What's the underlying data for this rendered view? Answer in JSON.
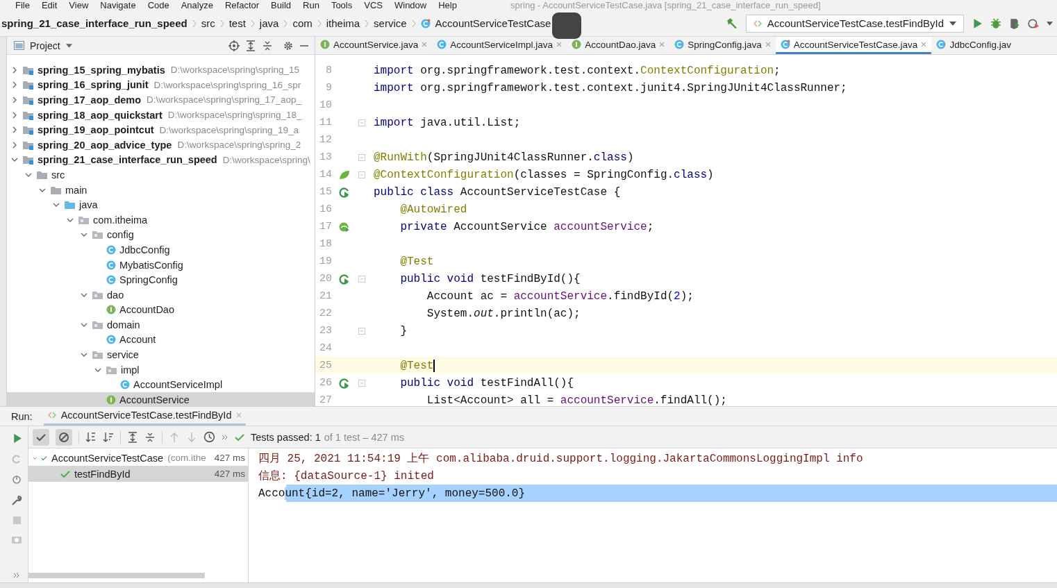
{
  "window": {
    "title": "spring - AccountServiceTestCase.java [spring_21_case_interface_run_speed]"
  },
  "menu": [
    "File",
    "Edit",
    "View",
    "Navigate",
    "Code",
    "Analyze",
    "Refactor",
    "Build",
    "Run",
    "Tools",
    "VCS",
    "Window",
    "Help"
  ],
  "breadcrumbs": [
    {
      "label": "spring_21_case_interface_run_speed",
      "kind": "module"
    },
    {
      "label": "src",
      "kind": "folder"
    },
    {
      "label": "test",
      "kind": "folder"
    },
    {
      "label": "java",
      "kind": "folder"
    },
    {
      "label": "com",
      "kind": "folder"
    },
    {
      "label": "itheima",
      "kind": "folder"
    },
    {
      "label": "service",
      "kind": "folder"
    },
    {
      "label": "AccountServiceTestCase",
      "kind": "class"
    }
  ],
  "run_config": {
    "label": "AccountServiceTestCase.testFindById"
  },
  "project": {
    "title": "Project",
    "tree": [
      {
        "name": "spring_15_spring_mybatis",
        "path": "D:\\workspace\\spring\\spring_15",
        "kind": "module",
        "expanded": false,
        "selected": false
      },
      {
        "name": "spring_16_spring_junit",
        "path": "D:\\workspace\\spring\\spring_16_spr",
        "kind": "module",
        "expanded": false,
        "selected": false
      },
      {
        "name": "spring_17_aop_demo",
        "path": "D:\\workspace\\spring\\spring_17_aop_",
        "kind": "module",
        "expanded": false,
        "selected": false
      },
      {
        "name": "spring_18_aop_quickstart",
        "path": "D:\\workspace\\spring\\spring_18_",
        "kind": "module",
        "expanded": false,
        "selected": false
      },
      {
        "name": "spring_19_aop_pointcut",
        "path": "D:\\workspace\\spring\\spring_19_a",
        "kind": "module",
        "expanded": false,
        "selected": false
      },
      {
        "name": "spring_20_aop_advice_type",
        "path": "D:\\workspace\\spring\\spring_2",
        "kind": "module",
        "expanded": false,
        "selected": false
      },
      {
        "name": "spring_21_case_interface_run_speed",
        "path": "D:\\workspace\\spring\\",
        "kind": "module",
        "expanded": true,
        "selected": false,
        "children": [
          {
            "name": "src",
            "kind": "folder",
            "expanded": true,
            "selected": false,
            "children": [
              {
                "name": "main",
                "kind": "folder",
                "expanded": true,
                "selected": false,
                "children": [
                  {
                    "name": "java",
                    "kind": "source",
                    "expanded": true,
                    "selected": false,
                    "children": [
                      {
                        "name": "com.itheima",
                        "kind": "package",
                        "expanded": true,
                        "selected": false,
                        "children": [
                          {
                            "name": "config",
                            "kind": "package",
                            "expanded": true,
                            "selected": false,
                            "children": [
                              {
                                "name": "JdbcConfig",
                                "kind": "class",
                                "selected": false
                              },
                              {
                                "name": "MybatisConfig",
                                "kind": "class",
                                "selected": false
                              },
                              {
                                "name": "SpringConfig",
                                "kind": "class",
                                "selected": false
                              }
                            ]
                          },
                          {
                            "name": "dao",
                            "kind": "package",
                            "expanded": true,
                            "selected": false,
                            "children": [
                              {
                                "name": "AccountDao",
                                "kind": "interface",
                                "selected": false
                              }
                            ]
                          },
                          {
                            "name": "domain",
                            "kind": "package",
                            "expanded": true,
                            "selected": false,
                            "children": [
                              {
                                "name": "Account",
                                "kind": "class",
                                "selected": false
                              }
                            ]
                          },
                          {
                            "name": "service",
                            "kind": "package",
                            "expanded": true,
                            "selected": false,
                            "children": [
                              {
                                "name": "impl",
                                "kind": "package",
                                "expanded": true,
                                "selected": false,
                                "children": [
                                  {
                                    "name": "AccountServiceImpl",
                                    "kind": "class",
                                    "selected": false
                                  }
                                ]
                              },
                              {
                                "name": "AccountService",
                                "kind": "interface",
                                "selected": true
                              }
                            ]
                          }
                        ]
                      }
                    ]
                  }
                ]
              }
            ]
          }
        ]
      }
    ]
  },
  "editor": {
    "tabs": [
      {
        "label": "AccountService.java",
        "kind": "interface",
        "selected": false,
        "closable": true
      },
      {
        "label": "AccountServiceImpl.java",
        "kind": "class",
        "selected": false,
        "closable": true
      },
      {
        "label": "AccountDao.java",
        "kind": "interface",
        "selected": false,
        "closable": true
      },
      {
        "label": "SpringConfig.java",
        "kind": "class",
        "selected": false,
        "closable": true
      },
      {
        "label": "AccountServiceTestCase.java",
        "kind": "test",
        "selected": true,
        "closable": true
      },
      {
        "label": "JdbcConfig.jav",
        "kind": "class",
        "selected": false,
        "closable": false
      }
    ],
    "lines": [
      {
        "num": "8",
        "fold": false,
        "current": false,
        "tokens": [
          {
            "text": "import",
            "kind": "keyword"
          },
          {
            "text": " org.springframework.test.context.",
            "kind": "plain"
          },
          {
            "text": "ContextConfiguration",
            "kind": "annotation"
          },
          {
            "text": ";",
            "kind": "plain"
          }
        ]
      },
      {
        "num": "9",
        "fold": false,
        "current": false,
        "tokens": [
          {
            "text": "import",
            "kind": "keyword"
          },
          {
            "text": " org.springframework.test.context.junit4.SpringJUnit4ClassRunner;",
            "kind": "plain"
          }
        ]
      },
      {
        "num": "10",
        "fold": false,
        "current": false
      },
      {
        "num": "11",
        "fold": true,
        "current": false,
        "tokens": [
          {
            "text": "import",
            "kind": "keyword"
          },
          {
            "text": " java.util.List;",
            "kind": "plain"
          }
        ]
      },
      {
        "num": "12",
        "fold": false,
        "current": false
      },
      {
        "num": "13",
        "fold": true,
        "current": false,
        "tokens": [
          {
            "text": "@RunWith",
            "kind": "annotation"
          },
          {
            "text": "(SpringJUnit4ClassRunner.",
            "kind": "plain"
          },
          {
            "text": "class",
            "kind": "keyword"
          },
          {
            "text": ")",
            "kind": "plain"
          }
        ]
      },
      {
        "num": "14",
        "fold": true,
        "current": false,
        "gutter": {
          "kind": "leaf"
        },
        "tokens": [
          {
            "text": "@ContextConfiguration",
            "kind": "annotation"
          },
          {
            "text": "(classes = SpringConfig.",
            "kind": "plain"
          },
          {
            "text": "class",
            "kind": "keyword"
          },
          {
            "text": ")",
            "kind": "plain"
          }
        ]
      },
      {
        "num": "15",
        "fold": false,
        "current": false,
        "gutter": {
          "kind": "run"
        },
        "tokens": [
          {
            "text": "public class",
            "kind": "keyword"
          },
          {
            "text": " AccountServiceTestCase {",
            "kind": "plain"
          }
        ]
      },
      {
        "num": "16",
        "fold": false,
        "current": false,
        "tokens": [
          {
            "text": "    @Autowired",
            "kind": "annotation"
          }
        ]
      },
      {
        "num": "17",
        "fold": false,
        "current": false,
        "gutter": {
          "kind": "bean"
        },
        "tokens": [
          {
            "text": "    private",
            "kind": "keyword"
          },
          {
            "text": " AccountService ",
            "kind": "plain"
          },
          {
            "text": "accountService",
            "kind": "field"
          },
          {
            "text": ";",
            "kind": "plain"
          }
        ]
      },
      {
        "num": "18",
        "fold": false,
        "current": false
      },
      {
        "num": "19",
        "fold": false,
        "current": false,
        "tokens": [
          {
            "text": "    @Test",
            "kind": "annotation"
          }
        ]
      },
      {
        "num": "20",
        "fold": true,
        "current": false,
        "gutter": {
          "kind": "run"
        },
        "tokens": [
          {
            "text": "    public void",
            "kind": "keyword"
          },
          {
            "text": " testFindById(){",
            "kind": "plain"
          }
        ]
      },
      {
        "num": "21",
        "fold": false,
        "current": false,
        "tokens": [
          {
            "text": "        Account ac = ",
            "kind": "plain"
          },
          {
            "text": "accountService",
            "kind": "field"
          },
          {
            "text": ".findById(",
            "kind": "plain"
          },
          {
            "text": "2",
            "kind": "number"
          },
          {
            "text": ");",
            "kind": "plain"
          }
        ]
      },
      {
        "num": "22",
        "fold": false,
        "current": false,
        "tokens": [
          {
            "text": "        System.",
            "kind": "plain"
          },
          {
            "text": "out",
            "kind": "static"
          },
          {
            "text": ".println(ac);",
            "kind": "plain"
          }
        ]
      },
      {
        "num": "23",
        "fold": true,
        "current": false,
        "tokens": [
          {
            "text": "    }",
            "kind": "plain"
          }
        ]
      },
      {
        "num": "24",
        "fold": false,
        "current": false
      },
      {
        "num": "25",
        "fold": false,
        "current": true,
        "tokens": [
          {
            "text": "    @Test",
            "kind": "annotation"
          }
        ]
      },
      {
        "num": "26",
        "fold": true,
        "current": false,
        "gutter": {
          "kind": "run"
        },
        "tokens": [
          {
            "text": "    public void",
            "kind": "keyword"
          },
          {
            "text": " testFindAll(){",
            "kind": "plain"
          }
        ]
      },
      {
        "num": "27",
        "fold": false,
        "current": false,
        "tokens": [
          {
            "text": "        List<Account> all = ",
            "kind": "plain"
          },
          {
            "text": "accountService",
            "kind": "field"
          },
          {
            "text": ".findAll();",
            "kind": "plain"
          }
        ]
      }
    ]
  },
  "run_panel": {
    "label": "Run:",
    "tab": {
      "label": "AccountServiceTestCase.testFindById"
    },
    "status": {
      "passed": "Tests passed: 1",
      "detail": "of 1 test – 427 ms"
    },
    "tests": [
      {
        "name": "AccountServiceTestCase",
        "detail": "(com.ithe",
        "time": "427 ms",
        "passed": true,
        "expanded": true,
        "selected": false,
        "children": [
          {
            "name": "testFindById",
            "time": "427 ms",
            "passed": true,
            "selected": true
          }
        ]
      }
    ],
    "console": [
      {
        "kind": "log",
        "segments": [
          {
            "text": "四月 25, 2021 11:54:19 上午 com.alibaba.druid.support.logging.JakartaCommonsLoggingImpl info",
            "selected": false
          }
        ]
      },
      {
        "kind": "log",
        "segments": [
          {
            "text": "信息: {dataSource-1} inited",
            "selected": false
          }
        ]
      },
      {
        "kind": "output",
        "segments": [
          {
            "text": "Acco",
            "selected": false
          },
          {
            "text": "unt{id=2, name='Jerry', money=500.0}",
            "selected": true
          }
        ]
      }
    ]
  }
}
